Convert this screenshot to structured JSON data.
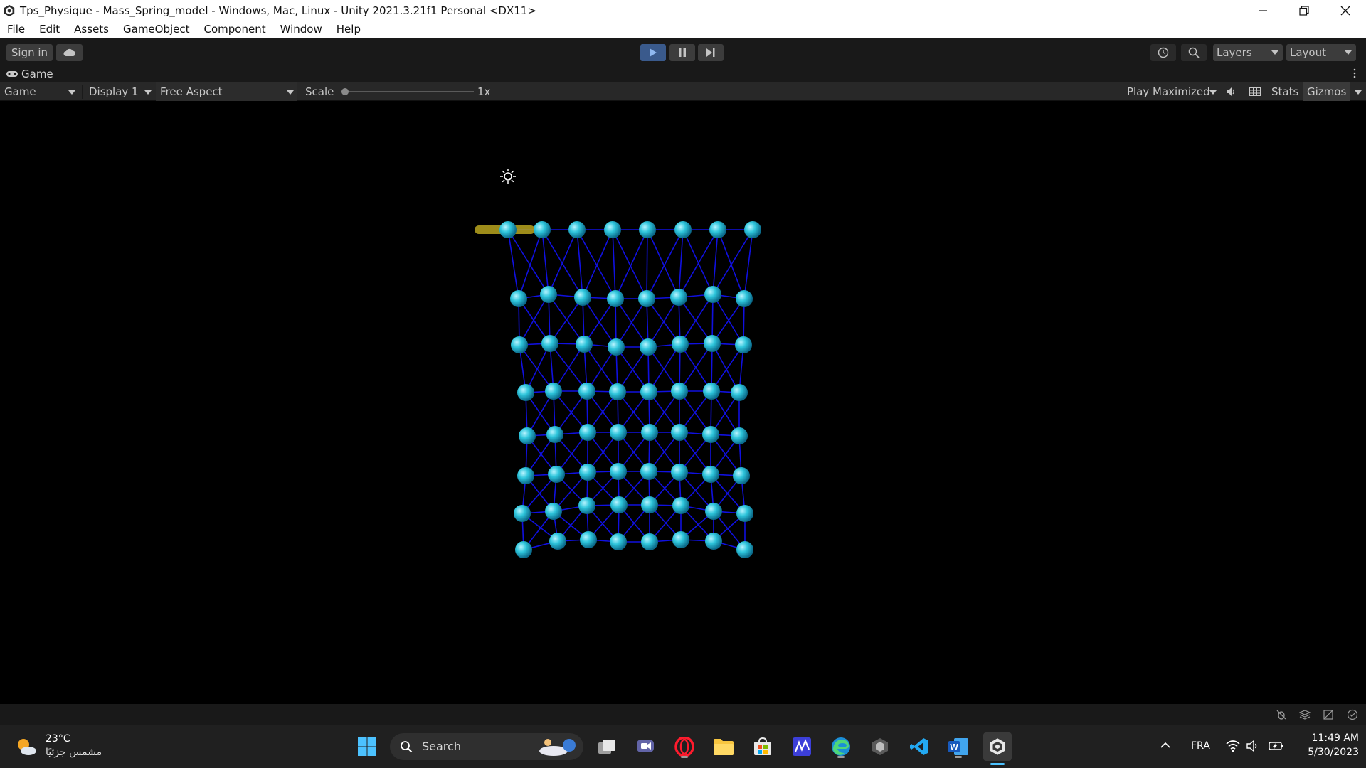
{
  "window": {
    "title": "Tps_Physique - Mass_Spring_model - Windows, Mac, Linux - Unity 2021.3.21f1 Personal <DX11>"
  },
  "menu": [
    "File",
    "Edit",
    "Assets",
    "GameObject",
    "Component",
    "Window",
    "Help"
  ],
  "toolbar": {
    "sign_in": "Sign in",
    "layers": "Layers",
    "layout": "Layout"
  },
  "game_tab": {
    "label": "Game"
  },
  "game_bar": {
    "view_mode": "Game",
    "display": "Display 1",
    "aspect": "Free Aspect",
    "scale_label": "Scale",
    "scale_value": "1x",
    "play_mode": "Play Maximized",
    "stats": "Stats",
    "gizmos": "Gizmos"
  },
  "scene": {
    "node_color": "#2fc6dc",
    "spring_color": "#1010e0",
    "selected_color": "#b9a51e"
  },
  "taskbar": {
    "weather_temp": "23°C",
    "weather_desc": "مشمس جزئيًا",
    "search_label": "Search",
    "language": "FRA",
    "time": "11:49 AM",
    "date": "5/30/2023"
  },
  "colors": {
    "accent_play": "#4a7fd0",
    "panel_bg": "#282828",
    "toolbar_bg": "#191919"
  }
}
